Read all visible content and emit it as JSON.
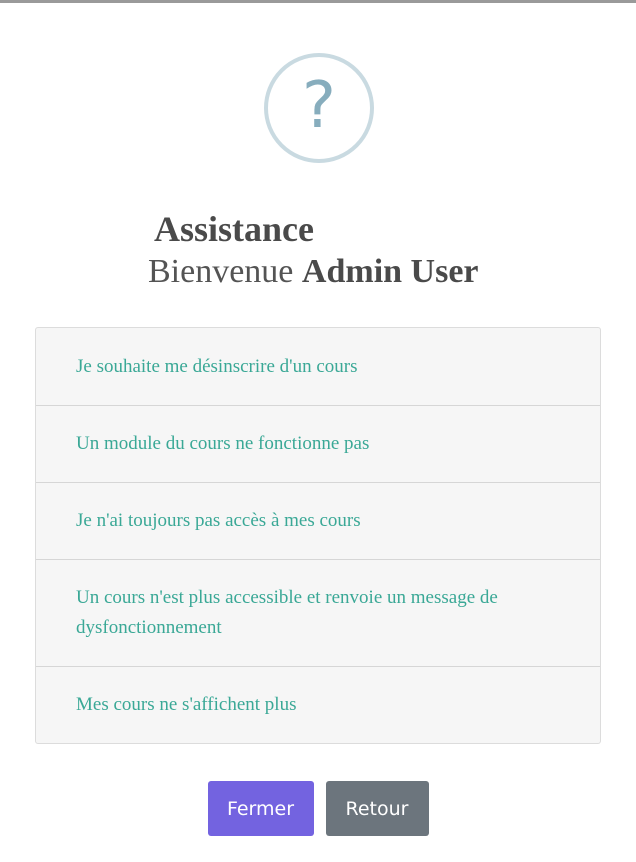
{
  "modal": {
    "icon_glyph": "?",
    "title": "Assistance",
    "welcome_prefix": "Bienvenue",
    "user_name": "Admin User"
  },
  "options": [
    "Je souhaite me désinscrire d'un cours",
    "Un module du cours ne fonctionne pas",
    "Je n'ai toujours pas accès à mes cours",
    "Un cours n'est plus accessible et renvoie un message de dysfonctionnement",
    "Mes cours ne s'affichent plus"
  ],
  "buttons": {
    "close_label": "Fermer",
    "back_label": "Retour"
  },
  "colors": {
    "link_teal": "#3aa896",
    "close_button": "#7363e0",
    "back_button": "#6c757d",
    "icon_ring": "#c9dae1"
  }
}
